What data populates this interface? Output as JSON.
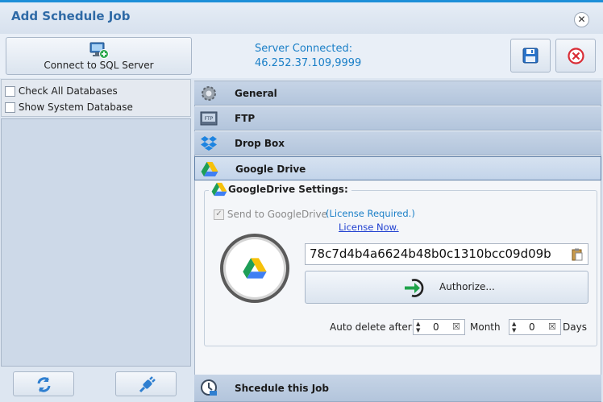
{
  "window": {
    "title": "Add Schedule Job",
    "close_label": "✕"
  },
  "toolbar": {
    "connect_label": "Connect to SQL Server",
    "server_status": "Server Connected:",
    "server_address": "46.252.37.109,9999"
  },
  "left_panel": {
    "check_all": "Check All Databases",
    "show_system": "Show System Database"
  },
  "accordion": {
    "general": "General",
    "ftp": "FTP",
    "ftp_icon_text": "FTP",
    "dropbox": "Drop Box",
    "google_drive": "Google Drive",
    "schedule": "Shcedule this Job"
  },
  "google_drive_settings": {
    "title": "GoogleDrive Settings:",
    "send_label": "Send to GoogleDrive",
    "send_checked": true,
    "license_required": "(License Required.)",
    "license_now": "License Now.",
    "token": "78c7d4b4a6624b48b0c1310bcc09d09b",
    "authorize_label": "Authorize...",
    "auto_delete_label": "Auto delete after:",
    "months_value": "0",
    "months_unit": "Month",
    "days_value": "0",
    "days_unit": "Days"
  },
  "colors": {
    "accent": "#1d8fd8",
    "link": "#1a7fc7",
    "header": "#b3c5dc"
  }
}
